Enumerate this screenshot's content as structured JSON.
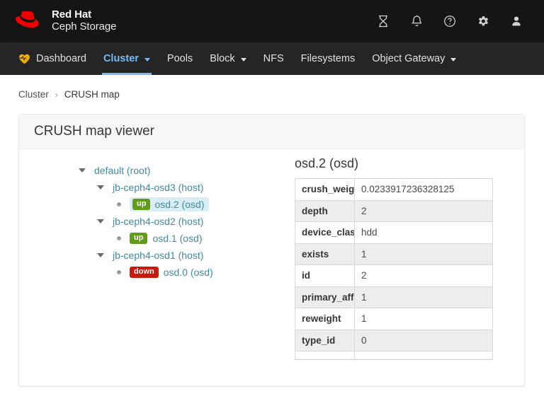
{
  "brand": {
    "line1": "Red Hat",
    "line2": "Ceph Storage",
    "logo_icon": "redhat-fedora-logo"
  },
  "topbar": {
    "icons": [
      {
        "name": "tasks-hourglass-icon",
        "glyph": "hourglass"
      },
      {
        "name": "notifications-bell-icon",
        "glyph": "bell"
      },
      {
        "name": "help-circle-icon",
        "glyph": "question-circle"
      },
      {
        "name": "settings-gear-icon",
        "glyph": "gear"
      },
      {
        "name": "user-account-icon",
        "glyph": "user"
      }
    ]
  },
  "nav": {
    "items": [
      {
        "label": "Dashboard",
        "active": false,
        "dropdown": false,
        "icon": "heart-pulse-icon"
      },
      {
        "label": "Cluster",
        "active": true,
        "dropdown": true
      },
      {
        "label": "Pools",
        "active": false,
        "dropdown": false
      },
      {
        "label": "Block",
        "active": false,
        "dropdown": true
      },
      {
        "label": "NFS",
        "active": false,
        "dropdown": false
      },
      {
        "label": "Filesystems",
        "active": false,
        "dropdown": false
      },
      {
        "label": "Object Gateway",
        "active": false,
        "dropdown": true
      }
    ]
  },
  "breadcrumb": {
    "parent": "Cluster",
    "separator": "›",
    "current": "CRUSH map"
  },
  "card": {
    "title": "CRUSH map viewer"
  },
  "tree": {
    "nodes": [
      {
        "level": 0,
        "label": "default (root)",
        "expanded": true,
        "type": "root",
        "selected": false,
        "badge": null
      },
      {
        "level": 1,
        "label": "jb-ceph4-osd3 (host)",
        "expanded": true,
        "type": "host",
        "selected": false,
        "badge": null
      },
      {
        "level": 2,
        "label": "osd.2 (osd)",
        "expanded": false,
        "type": "osd",
        "selected": true,
        "badge": "up",
        "badge_state": "up"
      },
      {
        "level": 1,
        "label": "jb-ceph4-osd2 (host)",
        "expanded": true,
        "type": "host",
        "selected": false,
        "badge": null
      },
      {
        "level": 2,
        "label": "osd.1 (osd)",
        "expanded": false,
        "type": "osd",
        "selected": false,
        "badge": "up",
        "badge_state": "up"
      },
      {
        "level": 1,
        "label": "jb-ceph4-osd1 (host)",
        "expanded": true,
        "type": "host",
        "selected": false,
        "badge": null
      },
      {
        "level": 2,
        "label": "osd.0 (osd)",
        "expanded": false,
        "type": "osd",
        "selected": false,
        "badge": "down",
        "badge_state": "down"
      }
    ]
  },
  "detail": {
    "title": "osd.2 (osd)",
    "rows": [
      {
        "key": "crush_weight",
        "value": "0.0233917236328125"
      },
      {
        "key": "depth",
        "value": "2"
      },
      {
        "key": "device_class",
        "value": "hdd"
      },
      {
        "key": "exists",
        "value": "1"
      },
      {
        "key": "id",
        "value": "2"
      },
      {
        "key": "primary_affinity",
        "value": "1"
      },
      {
        "key": "reweight",
        "value": "1"
      },
      {
        "key": "type_id",
        "value": "0"
      }
    ]
  },
  "colors": {
    "topbar_bg": "#151515",
    "navbar_bg": "#252525",
    "nav_active": "#73bcf7",
    "brand_red": "#ee0000",
    "heart_orange": "#f0ab00",
    "tree_link": "#3e8ba0",
    "badge_up": "#629b18",
    "badge_down": "#c9190b",
    "selected_bg": "#d9edf4"
  }
}
